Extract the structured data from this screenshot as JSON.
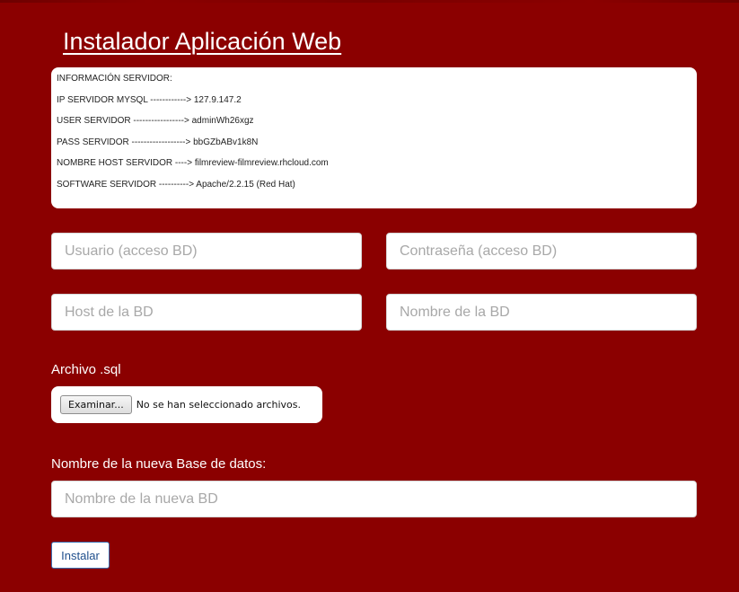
{
  "header": {
    "title": "Instalador Aplicación Web"
  },
  "server_info": {
    "lines": [
      "INFORMACIÓN SERVIDOR:",
      "IP SERVIDOR MYSQL ------------> 127.9.147.2",
      "USER SERVIDOR -----------------> adminWh26xgz",
      "PASS SERVIDOR ------------------> bbGZbABv1k8N",
      "NOMBRE HOST SERVIDOR ----> filmreview-filmreview.rhcloud.com",
      "SOFTWARE SERVIDOR ----------> Apache/2.2.15 (Red Hat)"
    ]
  },
  "form": {
    "user_placeholder": "Usuario (acceso BD)",
    "password_placeholder": "Contraseña (acceso BD)",
    "host_placeholder": "Host de la BD",
    "dbname_placeholder": "Nombre de la BD",
    "sql_file_label": "Archivo .sql",
    "file_button_label": "Examinar...",
    "file_status": "No se han seleccionado archivos.",
    "new_db_label": "Nombre de la nueva Base de datos:",
    "new_db_placeholder": "Nombre de la nueva BD",
    "submit_label": "Instalar"
  },
  "colors": {
    "background": "#8b0000",
    "panel": "#ffffff",
    "button_border": "#3b6fb2"
  }
}
